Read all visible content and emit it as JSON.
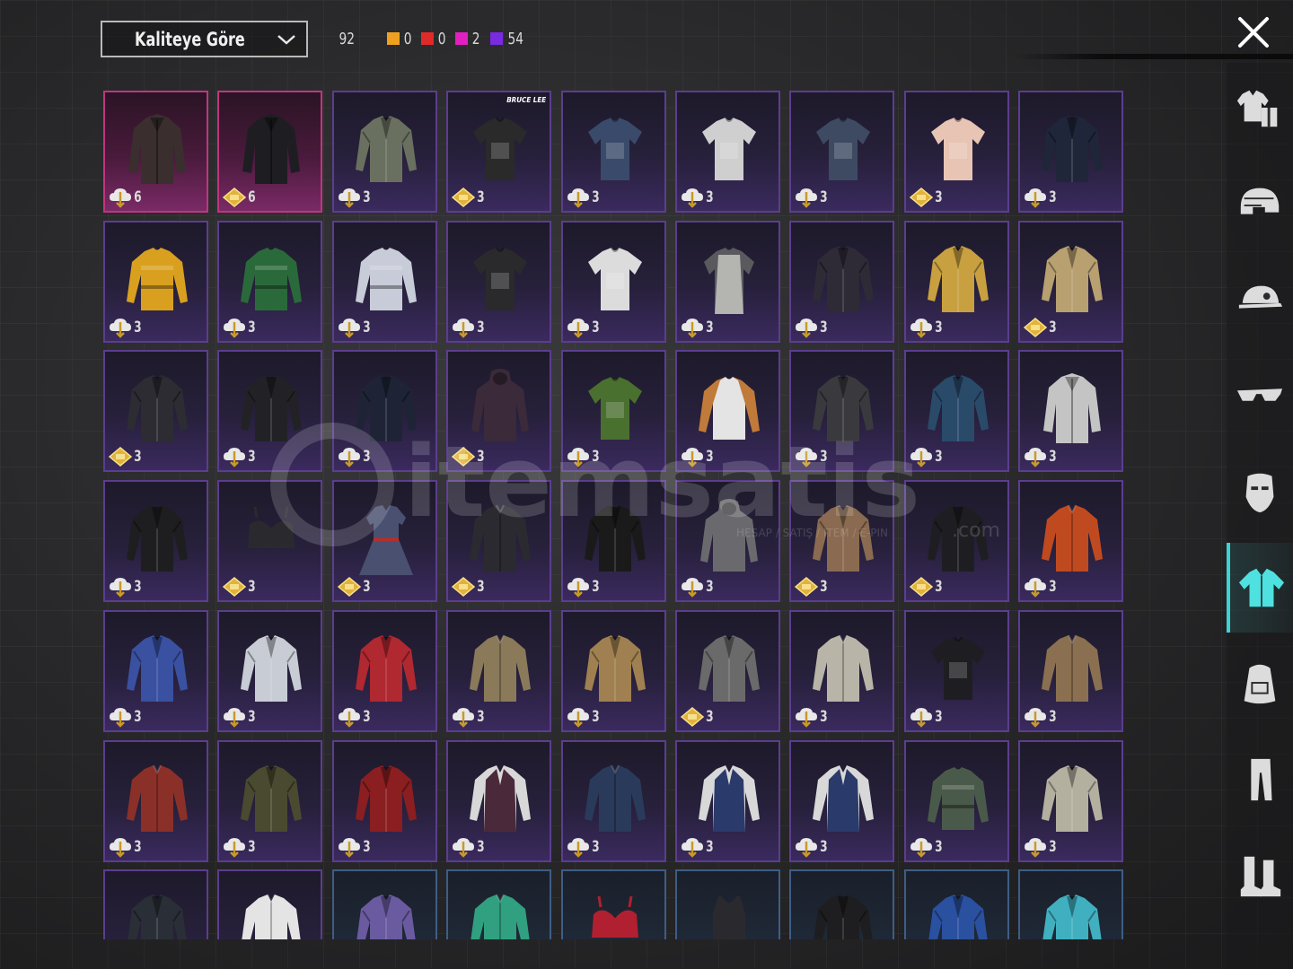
{
  "sort": {
    "label": "Kaliteye Göre"
  },
  "counts": {
    "total": "92",
    "tiers": [
      {
        "color": "#f0a020",
        "value": "0"
      },
      {
        "color": "#e02a2a",
        "value": "0"
      },
      {
        "color": "#e020c0",
        "value": "2"
      },
      {
        "color": "#7a2ae0",
        "value": "54"
      }
    ]
  },
  "watermark": {
    "brand": "itemsatis",
    "tagline": "HESAP / SATIŞ / ITEM / E-PIN",
    "suffix": ".com"
  },
  "categories": [
    {
      "name": "outfit-icon"
    },
    {
      "name": "helmet-icon"
    },
    {
      "name": "cap-icon"
    },
    {
      "name": "glasses-icon"
    },
    {
      "name": "mask-icon"
    },
    {
      "name": "shirt-icon",
      "active": true
    },
    {
      "name": "backpack-icon"
    },
    {
      "name": "pants-icon"
    },
    {
      "name": "boots-icon"
    }
  ],
  "items": [
    {
      "r": 0,
      "c": 0,
      "rarity": "pink",
      "badge": "cloud",
      "level": "6",
      "color": "#3a2e2e",
      "kind": "coat"
    },
    {
      "r": 0,
      "c": 1,
      "rarity": "pink",
      "badge": "diamond",
      "level": "6",
      "color": "#1e1e22",
      "kind": "coat"
    },
    {
      "r": 0,
      "c": 2,
      "rarity": "purple",
      "badge": "cloud",
      "level": "3",
      "color": "#6a7060",
      "kind": "jacket"
    },
    {
      "r": 0,
      "c": 3,
      "rarity": "purple",
      "badge": "diamond",
      "level": "3",
      "color": "#2a2a2a",
      "kind": "tshirt",
      "brand": "BRUCE LEE"
    },
    {
      "r": 0,
      "c": 4,
      "rarity": "purple",
      "badge": "cloud",
      "level": "3",
      "color": "#3a4a6a",
      "kind": "tshirt"
    },
    {
      "r": 0,
      "c": 5,
      "rarity": "purple",
      "badge": "cloud",
      "level": "3",
      "color": "#cfcfcf",
      "kind": "tshirt"
    },
    {
      "r": 0,
      "c": 6,
      "rarity": "purple",
      "badge": "cloud",
      "level": "3",
      "color": "#3e4a62",
      "kind": "tshirt"
    },
    {
      "r": 0,
      "c": 7,
      "rarity": "purple",
      "badge": "diamond",
      "level": "3",
      "color": "#e8c4b4",
      "kind": "tshirt"
    },
    {
      "r": 0,
      "c": 8,
      "rarity": "purple",
      "badge": "cloud",
      "level": "3",
      "color": "#20263a",
      "kind": "jacket"
    },
    {
      "r": 1,
      "c": 0,
      "rarity": "purple",
      "badge": "cloud",
      "level": "3",
      "color": "#d9a020",
      "kind": "sweater"
    },
    {
      "r": 1,
      "c": 1,
      "rarity": "purple",
      "badge": "cloud",
      "level": "3",
      "color": "#2a6a3a",
      "kind": "sweater"
    },
    {
      "r": 1,
      "c": 2,
      "rarity": "purple",
      "badge": "cloud",
      "level": "3",
      "color": "#c8ccd8",
      "kind": "sweater"
    },
    {
      "r": 1,
      "c": 3,
      "rarity": "purple",
      "badge": "cloud",
      "level": "3",
      "color": "#2a2a2c",
      "kind": "tshirt"
    },
    {
      "r": 1,
      "c": 4,
      "rarity": "purple",
      "badge": "cloud",
      "level": "3",
      "color": "#dcdcdc",
      "kind": "tshirt"
    },
    {
      "r": 1,
      "c": 5,
      "rarity": "purple",
      "badge": "cloud",
      "level": "3",
      "color": "#b4b4b0",
      "kind": "apron"
    },
    {
      "r": 1,
      "c": 6,
      "rarity": "purple",
      "badge": "cloud",
      "level": "3",
      "color": "#2e2a36",
      "kind": "jacket"
    },
    {
      "r": 1,
      "c": 7,
      "rarity": "purple",
      "badge": "cloud",
      "level": "3",
      "color": "#c8a040",
      "kind": "jacket"
    },
    {
      "r": 1,
      "c": 8,
      "rarity": "purple",
      "badge": "diamond",
      "level": "3",
      "color": "#b8a070",
      "kind": "jacket"
    },
    {
      "r": 2,
      "c": 0,
      "rarity": "purple",
      "badge": "diamond",
      "level": "3",
      "color": "#2c2c32",
      "kind": "jacket"
    },
    {
      "r": 2,
      "c": 1,
      "rarity": "purple",
      "badge": "cloud",
      "level": "3",
      "color": "#222226",
      "kind": "jacket"
    },
    {
      "r": 2,
      "c": 2,
      "rarity": "purple",
      "badge": "cloud",
      "level": "3",
      "color": "#1e2436",
      "kind": "jacket"
    },
    {
      "r": 2,
      "c": 3,
      "rarity": "purple",
      "badge": "diamond",
      "level": "3",
      "color": "#3a2a3a",
      "kind": "hoodie"
    },
    {
      "r": 2,
      "c": 4,
      "rarity": "purple",
      "badge": "cloud",
      "level": "3",
      "color": "#4a7030",
      "kind": "tshirt"
    },
    {
      "r": 2,
      "c": 5,
      "rarity": "purple",
      "badge": "cloud",
      "level": "3",
      "color": "#e4e4e4",
      "kind": "raglan"
    },
    {
      "r": 2,
      "c": 6,
      "rarity": "purple",
      "badge": "cloud",
      "level": "3",
      "color": "#3a3a3e",
      "kind": "jacket"
    },
    {
      "r": 2,
      "c": 7,
      "rarity": "purple",
      "badge": "cloud",
      "level": "3",
      "color": "#2a4a6a",
      "kind": "jacket"
    },
    {
      "r": 2,
      "c": 8,
      "rarity": "purple",
      "badge": "cloud",
      "level": "3",
      "color": "#c4c4c4",
      "kind": "coat"
    },
    {
      "r": 3,
      "c": 0,
      "rarity": "purple",
      "badge": "cloud",
      "level": "3",
      "color": "#1e1e20",
      "kind": "jacket"
    },
    {
      "r": 3,
      "c": 1,
      "rarity": "purple",
      "badge": "diamond",
      "level": "3",
      "color": "#2a2a2e",
      "kind": "bra"
    },
    {
      "r": 3,
      "c": 2,
      "rarity": "purple",
      "badge": "diamond",
      "level": "3",
      "color": "#4a5070",
      "kind": "dress"
    },
    {
      "r": 3,
      "c": 3,
      "rarity": "purple",
      "badge": "diamond",
      "level": "3",
      "color": "#2a2a30",
      "kind": "shirt"
    },
    {
      "r": 3,
      "c": 4,
      "rarity": "purple",
      "badge": "cloud",
      "level": "3",
      "color": "#1a1a1a",
      "kind": "jacket"
    },
    {
      "r": 3,
      "c": 5,
      "rarity": "purple",
      "badge": "cloud",
      "level": "3",
      "color": "#6a6a6e",
      "kind": "hoodie"
    },
    {
      "r": 3,
      "c": 6,
      "rarity": "purple",
      "badge": "diamond",
      "level": "3",
      "color": "#8a6a50",
      "kind": "jacket"
    },
    {
      "r": 3,
      "c": 7,
      "rarity": "purple",
      "badge": "diamond",
      "level": "3",
      "color": "#1e1e22",
      "kind": "jacket"
    },
    {
      "r": 3,
      "c": 8,
      "rarity": "purple",
      "badge": "cloud",
      "level": "3",
      "color": "#c04a20",
      "kind": "shirt"
    },
    {
      "r": 4,
      "c": 0,
      "rarity": "purple",
      "badge": "cloud",
      "level": "3",
      "color": "#3a50a0",
      "kind": "jacket"
    },
    {
      "r": 4,
      "c": 1,
      "rarity": "purple",
      "badge": "cloud",
      "level": "3",
      "color": "#c8ccd4",
      "kind": "jacket"
    },
    {
      "r": 4,
      "c": 2,
      "rarity": "purple",
      "badge": "cloud",
      "level": "3",
      "color": "#b02830",
      "kind": "jacket"
    },
    {
      "r": 4,
      "c": 3,
      "rarity": "purple",
      "badge": "cloud",
      "level": "3",
      "color": "#8a7a5a",
      "kind": "shirt"
    },
    {
      "r": 4,
      "c": 4,
      "rarity": "purple",
      "badge": "cloud",
      "level": "3",
      "color": "#a08050",
      "kind": "jacket"
    },
    {
      "r": 4,
      "c": 5,
      "rarity": "purple",
      "badge": "diamond",
      "level": "3",
      "color": "#6a6a6a",
      "kind": "jacket"
    },
    {
      "r": 4,
      "c": 6,
      "rarity": "purple",
      "badge": "cloud",
      "level": "3",
      "color": "#b8b4a8",
      "kind": "shirt"
    },
    {
      "r": 4,
      "c": 7,
      "rarity": "purple",
      "badge": "cloud",
      "level": "3",
      "color": "#1e1e22",
      "kind": "tshirt"
    },
    {
      "r": 4,
      "c": 8,
      "rarity": "purple",
      "badge": "cloud",
      "level": "3",
      "color": "#8a7050",
      "kind": "shirt"
    },
    {
      "r": 5,
      "c": 0,
      "rarity": "purple",
      "badge": "cloud",
      "level": "3",
      "color": "#8a3028",
      "kind": "shirt"
    },
    {
      "r": 5,
      "c": 1,
      "rarity": "purple",
      "badge": "cloud",
      "level": "3",
      "color": "#4a4a30",
      "kind": "jacket"
    },
    {
      "r": 5,
      "c": 2,
      "rarity": "purple",
      "badge": "cloud",
      "level": "3",
      "color": "#8a1e20",
      "kind": "jacket"
    },
    {
      "r": 5,
      "c": 3,
      "rarity": "purple",
      "badge": "cloud",
      "level": "3",
      "color": "#4a2a3a",
      "kind": "vest"
    },
    {
      "r": 5,
      "c": 4,
      "rarity": "purple",
      "badge": "cloud",
      "level": "3",
      "color": "#2a3a5a",
      "kind": "shirt"
    },
    {
      "r": 5,
      "c": 5,
      "rarity": "purple",
      "badge": "cloud",
      "level": "3",
      "color": "#2a3a6a",
      "kind": "vest"
    },
    {
      "r": 5,
      "c": 6,
      "rarity": "purple",
      "badge": "cloud",
      "level": "3",
      "color": "#2a3a6a",
      "kind": "vest"
    },
    {
      "r": 5,
      "c": 7,
      "rarity": "purple",
      "badge": "cloud",
      "level": "3",
      "color": "#4a5a4a",
      "kind": "sweater"
    },
    {
      "r": 5,
      "c": 8,
      "rarity": "purple",
      "badge": "cloud",
      "level": "3",
      "color": "#b4b0a0",
      "kind": "jacket"
    },
    {
      "r": 6,
      "c": 0,
      "rarity": "purple",
      "badge": "cloud",
      "level": "",
      "color": "#2a2e36",
      "kind": "jacket"
    },
    {
      "r": 6,
      "c": 1,
      "rarity": "purple",
      "badge": "cloud",
      "level": "",
      "color": "#e4e4e4",
      "kind": "shirt"
    },
    {
      "r": 6,
      "c": 2,
      "rarity": "blue",
      "badge": "cloud",
      "level": "",
      "color": "#6a5aa0",
      "kind": "jacket"
    },
    {
      "r": 6,
      "c": 3,
      "rarity": "blue",
      "badge": "cloud",
      "level": "",
      "color": "#30a080",
      "kind": "shirt"
    },
    {
      "r": 6,
      "c": 4,
      "rarity": "blue",
      "badge": "cloud",
      "level": "",
      "color": "#b02030",
      "kind": "bra"
    },
    {
      "r": 6,
      "c": 5,
      "rarity": "blue",
      "badge": "cloud",
      "level": "",
      "color": "#2a2a2e",
      "kind": "tank"
    },
    {
      "r": 6,
      "c": 6,
      "rarity": "blue",
      "badge": "cloud",
      "level": "",
      "color": "#1e1e20",
      "kind": "jacket"
    },
    {
      "r": 6,
      "c": 7,
      "rarity": "blue",
      "badge": "cloud",
      "level": "",
      "color": "#2a50a0",
      "kind": "jacket"
    },
    {
      "r": 6,
      "c": 8,
      "rarity": "blue",
      "badge": "cloud",
      "level": "",
      "color": "#40b0c0",
      "kind": "jacket"
    }
  ]
}
